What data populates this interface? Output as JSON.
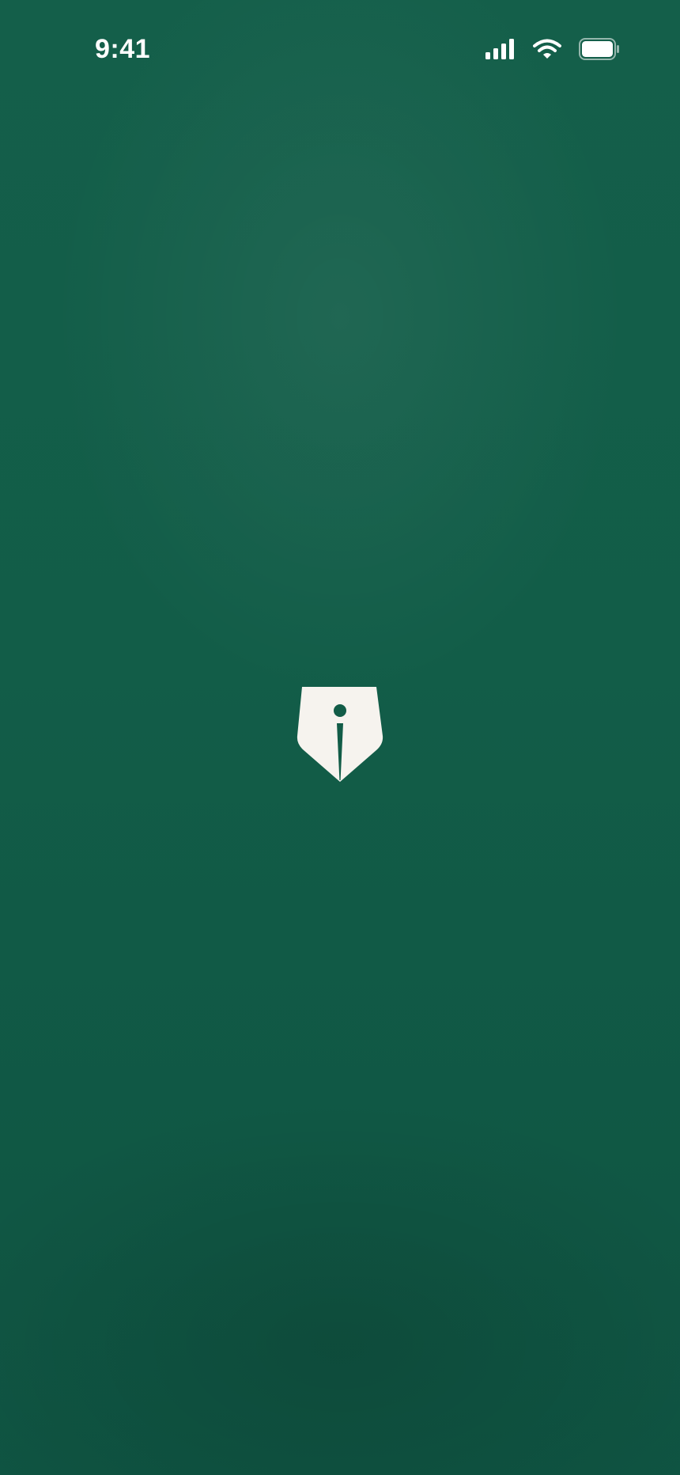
{
  "status_bar": {
    "time": "9:41",
    "icons": [
      "cellular-signal-icon",
      "wifi-icon",
      "battery-icon"
    ],
    "battery_level": 1.0
  },
  "splash": {
    "logo_icon": "fountain-pen-nib-icon"
  },
  "colors": {
    "background": "#125c47",
    "foreground": "#ffffff",
    "logo": "#f6f3ee"
  }
}
